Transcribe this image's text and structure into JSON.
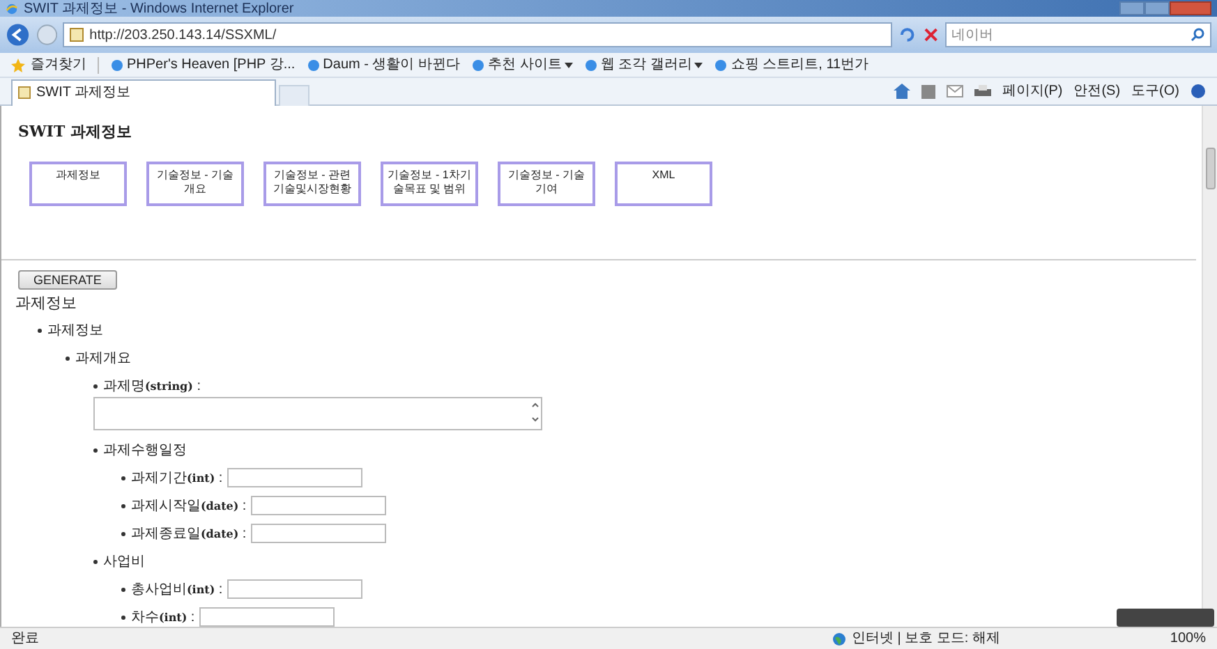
{
  "window": {
    "title": "SWIT 과제정보 - Windows Internet Explorer"
  },
  "address_bar": {
    "url": "http://203.250.143.14/SSXML/"
  },
  "search": {
    "placeholder": "네이버"
  },
  "favorites_bar": {
    "label": "즐겨찾기",
    "items": [
      {
        "label": "PHPer's Heaven [PHP 강...",
        "dropdown": false
      },
      {
        "label": "Daum - 생활이 바뀐다",
        "dropdown": false
      },
      {
        "label": "추천 사이트",
        "dropdown": true
      },
      {
        "label": "웹 조각 갤러리",
        "dropdown": true
      },
      {
        "label": "쇼핑 스트리트, 11번가",
        "dropdown": false
      }
    ]
  },
  "tabs": [
    {
      "label": "SWIT 과제정보",
      "selected": true
    }
  ],
  "command_bar": [
    "페이지(P)",
    "안전(S)",
    "도구(O)"
  ],
  "page": {
    "heading": "SWIT 과제정보",
    "nav_buttons": [
      "과제정보",
      "기술정보 - 기술개요",
      "기술정보 - 관련기술및시장현황",
      "기술정보 - 1차기술목표 및 범위",
      "기술정보 - 기술기여",
      "XML"
    ],
    "generate_button": "GENERATE",
    "section_title": "과제정보",
    "tree": [
      {
        "label": "과제정보",
        "children": [
          {
            "label": "과제개요",
            "children": [
              {
                "label": "과제명**(string)** :",
                "kind": "textarea"
              },
              {
                "label": "과제수행일정",
                "children": [
                  {
                    "label": "과제기간**(int)** :",
                    "kind": "input"
                  },
                  {
                    "label": "과제시작일**(date)** :",
                    "kind": "input"
                  },
                  {
                    "label": "과제종료일**(date)** :",
                    "kind": "input"
                  }
                ]
              },
              {
                "label": "사업비",
                "children": [
                  {
                    "label": "총사업비**(int)** :",
                    "kind": "input"
                  },
                  {
                    "label": "차수**(int)** :",
                    "kind": "input"
                  }
                ]
              }
            ]
          }
        ]
      }
    ]
  },
  "status_bar": {
    "text": "완료",
    "zone": "인터넷 | 보호 모드: 해제",
    "zoom": "100%"
  }
}
